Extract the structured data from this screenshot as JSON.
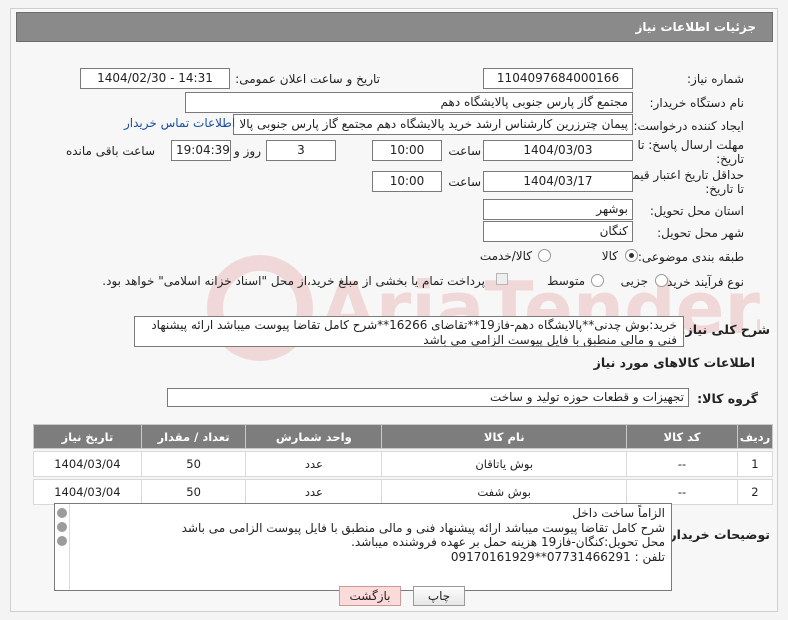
{
  "header": {
    "title": "جزئیات اطلاعات نیاز"
  },
  "fields": {
    "need_number_label": "شماره نیاز:",
    "need_number": "1104097684000166",
    "announce_label": "تاریخ و ساعت اعلان عمومی:",
    "announce_value": "1404/02/30 - 14:31",
    "buyer_org_label": "نام دستگاه خریدار:",
    "buyer_org": "مجتمع گاز پارس جنوبی  پالایشگاه دهم",
    "requester_label": "ایجاد کننده درخواست:",
    "requester": "پیمان چترزرین کارشناس ارشد خرید پالایشگاه دهم مجتمع گاز پارس جنوبی  پالا",
    "contact_link": "اطلاعات تماس خریدار",
    "deadline_label_1": "مهلت ارسال پاسخ: تا",
    "deadline_label_2": "تاریخ:",
    "deadline_date": "1404/03/03",
    "time_label": "ساعت",
    "deadline_time": "10:00",
    "days_value": "3",
    "days_label": "روز و",
    "remaining_time": "19:04:39",
    "remaining_label": "ساعت باقی مانده",
    "validity_label_1": "حداقل تاریخ اعتبار قیمت:",
    "validity_label_2": "تا تاریخ:",
    "validity_date": "1404/03/17",
    "validity_time": "10:00",
    "province_label": "استان محل تحویل:",
    "province": "بوشهر",
    "city_label": "شهر محل تحویل:",
    "city": "کنگان",
    "category_label": "طبقه بندی موضوعی:",
    "category_options": [
      "کالا",
      "کالا/خدمت"
    ],
    "category_selected": "کالا",
    "process_label": "نوع فرآیند خرید :",
    "process_options": [
      "جزیی",
      "متوسط"
    ],
    "process_note": "پرداخت تمام یا بخشی از مبلغ خرید،از محل \"اسناد خزانه اسلامی\" خواهد بود.",
    "description_label": "شرح کلی نیاز:",
    "description": "خرید:بوش چدنی**پالایشگاه دهم-فاز19**تقاضای 16266**شرح کامل تقاضا پیوست میباشد ارائه پیشنهاد فنی و مالی منطبق با فایل پیوست الزامی می باشد"
  },
  "goods": {
    "section_title": "اطلاعات کالاهای مورد نیاز",
    "group_label": "گروه کالا:",
    "group_value": "تجهیزات و قطعات حوزه تولید و ساخت",
    "columns": [
      "ردیف",
      "کد کالا",
      "نام کالا",
      "واحد شمارش",
      "تعداد / مقدار",
      "تاریخ نیاز"
    ],
    "rows": [
      {
        "row": "1",
        "code": "--",
        "name": "بوش یاتاقان",
        "unit": "عدد",
        "qty": "50",
        "date": "1404/03/04"
      },
      {
        "row": "2",
        "code": "--",
        "name": "بوش شفت",
        "unit": "عدد",
        "qty": "50",
        "date": "1404/03/04"
      }
    ]
  },
  "buyer_notes": {
    "label": "توضیحات خریدار:",
    "lines": [
      "الزاماً ساخت داخل",
      "شرح کامل تقاضا پیوست میباشد ارائه پیشنهاد فنی و مالی منطبق با فایل پیوست الزامی می باشد",
      "محل تحویل:کنگان-فاز19 هزینه حمل بر عهده فروشنده میباشد.",
      "تلفن : 07731466291**09170161929"
    ]
  },
  "buttons": {
    "print": "چاپ",
    "back": "بازگشت"
  },
  "watermark": "AriaTender.neT"
}
